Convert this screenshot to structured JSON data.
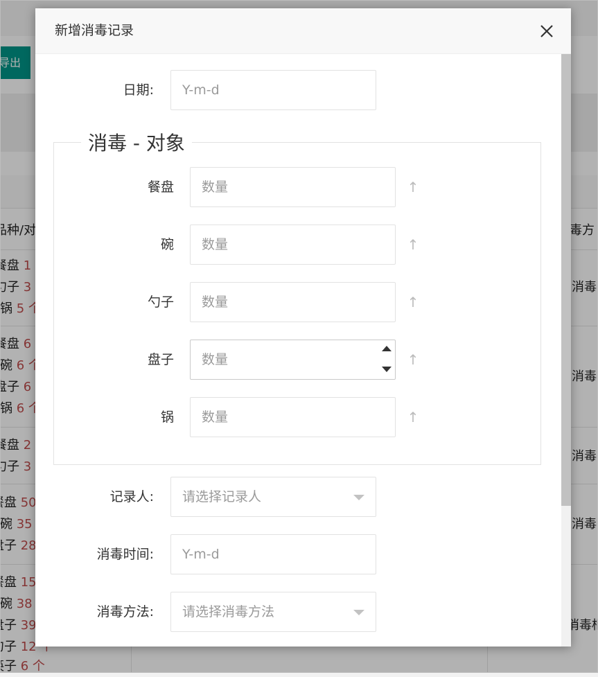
{
  "background": {
    "export_label": "导出",
    "table_headers": [
      "品种/对",
      "毒方"
    ],
    "rows": [
      {
        "items": [
          {
            "name": "餐盘",
            "num": "1"
          },
          {
            "name": "勺子",
            "num": "3"
          },
          {
            "name": "锅",
            "num": "5 个"
          }
        ],
        "method": "消毒"
      },
      {
        "items": [
          {
            "name": "餐盘",
            "num": "6"
          },
          {
            "name": "碗",
            "num": "6 个"
          },
          {
            "name": "盘子",
            "num": "6"
          },
          {
            "name": "锅",
            "num": "6 个"
          }
        ],
        "method": "消毒"
      },
      {
        "items": [
          {
            "name": "餐盘",
            "num": "2"
          },
          {
            "name": "勺子",
            "num": "3"
          }
        ],
        "method": "消毒"
      },
      {
        "items": [
          {
            "name": "餐盘",
            "num": "50"
          },
          {
            "name": "碗",
            "num": "35"
          },
          {
            "name": "盘子",
            "num": "28"
          }
        ],
        "method": "消毒"
      },
      {
        "items": [
          {
            "name": "餐盘",
            "num": "15"
          },
          {
            "name": "碗",
            "num": "38"
          },
          {
            "name": "盘子",
            "num": "39"
          },
          {
            "name": "勺子",
            "num": "12 个"
          },
          {
            "name": "筷子",
            "num": "6 个"
          }
        ],
        "method": "消毒柜"
      }
    ]
  },
  "modal": {
    "title": "新增消毒记录",
    "date": {
      "label": "日期:",
      "placeholder": "Y-m-d"
    },
    "objects": {
      "legend": "消毒 - 对象",
      "quantity_placeholder": "数量",
      "up_symbol": "↑",
      "items": [
        {
          "label": "餐盘",
          "placeholder": "数量"
        },
        {
          "label": "碗",
          "placeholder": "数量"
        },
        {
          "label": "勺子",
          "placeholder": "数量"
        },
        {
          "label": "盘子",
          "placeholder": "数量"
        },
        {
          "label": "锅",
          "placeholder": "数量"
        }
      ]
    },
    "recorder": {
      "label": "记录人:",
      "placeholder": "请选择记录人"
    },
    "disinfect_time": {
      "label": "消毒时间:",
      "placeholder": "Y-m-d"
    },
    "disinfect_method": {
      "label": "消毒方法:",
      "placeholder": "请选择消毒方法"
    }
  }
}
